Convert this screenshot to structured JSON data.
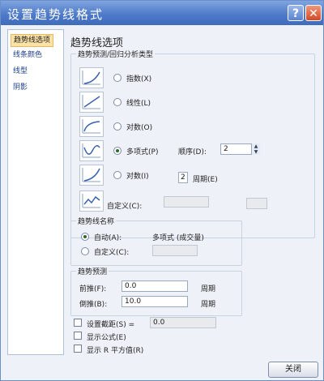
{
  "window": {
    "title": "设置趋势线格式",
    "help_label": "?",
    "close_label": "✕"
  },
  "nav": {
    "items": [
      {
        "label": "趋势线选项",
        "selected": true
      },
      {
        "label": "线条颜色",
        "selected": false
      },
      {
        "label": "线型",
        "selected": false
      },
      {
        "label": "阴影",
        "selected": false
      }
    ]
  },
  "panel": {
    "heading": "趋势线选项",
    "type_group": {
      "legend": "趋势预测/回归分析类型",
      "options": [
        {
          "label": "指数(X)",
          "thumb_icon": "exponential-curve-icon",
          "selected": false
        },
        {
          "label": "线性(L)",
          "thumb_icon": "linear-line-icon",
          "selected": false
        },
        {
          "label": "对数(O)",
          "thumb_icon": "logarithmic-curve-icon",
          "selected": false
        },
        {
          "label": "多项式(P)",
          "thumb_icon": "polynomial-curve-icon",
          "selected": true
        },
        {
          "label": "对数(I)",
          "thumb_icon": "power-curve-icon",
          "selected": false
        }
      ],
      "order_label": "顺序(D):",
      "order_value": "2",
      "period_value": "2",
      "period_label": "周期(E)",
      "custom_label": "自定义(C):",
      "custom_thumb_icon": "moving-average-icon"
    },
    "name_group": {
      "legend": "趋势线名称",
      "auto_label": "自动(A):",
      "auto_value": "多项式 (成交量)",
      "auto_selected": true,
      "custom_label": "自定义(C):",
      "custom_value": ""
    },
    "forecast_group": {
      "legend": "趋势预测",
      "forward_label": "前推(F):",
      "forward_value": "0.0",
      "forward_unit": "周期",
      "backward_label": "倒推(B):",
      "backward_value": "10.0",
      "backward_unit": "周期"
    },
    "checks": [
      {
        "label": "设置截距(S) =",
        "value": "0.0",
        "checked": false
      },
      {
        "label": "显示公式(E)",
        "checked": false
      },
      {
        "label": "显示 R 平方值(R)",
        "checked": false
      }
    ]
  },
  "footer": {
    "close_button": "关闭"
  },
  "colors": {
    "accent": "#4f7bc9",
    "selection": "#fbe2a6",
    "close": "#d24a26"
  }
}
